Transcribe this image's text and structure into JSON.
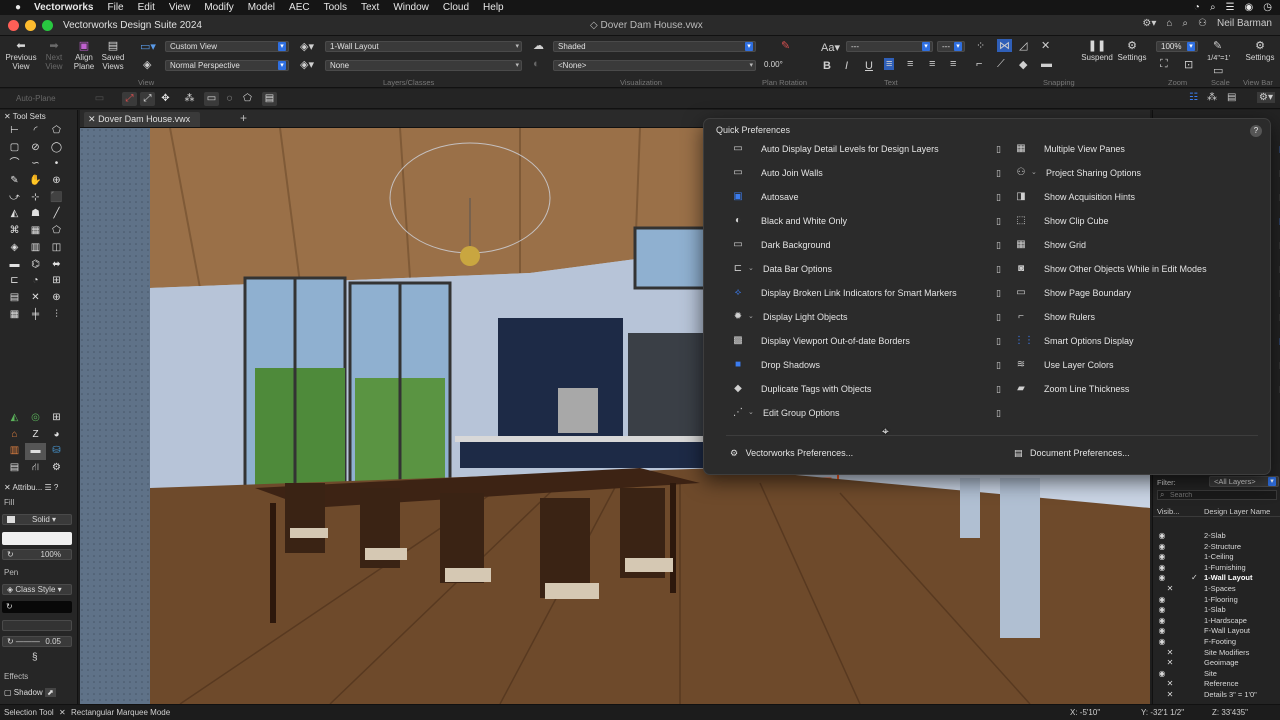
{
  "menubar": {
    "app": "Vectorworks",
    "items": [
      "File",
      "Edit",
      "View",
      "Modify",
      "Model",
      "AEC",
      "Tools",
      "Text",
      "Window",
      "Cloud",
      "Help"
    ]
  },
  "window": {
    "title": "Vectorworks Design Suite 2024",
    "document": "Dover Dam House.vwx",
    "user": "Neil Barman"
  },
  "toolbar": {
    "previous_view": "Previous\nView",
    "next_view": "Next\nView",
    "align_plane": "Align\nPlane",
    "saved_views": "Saved\nViews",
    "view_dropdown": "Custom View",
    "projection_dropdown": "Normal Perspective",
    "layer_dropdown": "1-Wall Layout",
    "class_dropdown": "None",
    "render_dropdown": "Shaded",
    "lighting_dropdown": "<None>",
    "plan_rotation_value": "0.00°",
    "zoom_value": "100%",
    "scale_value": "1/4\"=1'",
    "suspend": "Suspend",
    "settings": "Settings",
    "settings2": "Settings",
    "groups": {
      "view": "View",
      "layers_classes": "Layers/Classes",
      "visualization": "Visualization",
      "plan_rotation": "Plan Rotation",
      "text": "Text",
      "snapping": "Snapping",
      "zoom": "Zoom",
      "scale": "Scale",
      "view_bar": "View Bar"
    }
  },
  "mode_bar": {
    "auto_plane": "Auto-Plane"
  },
  "left_palette": {
    "tool_sets": "Tool Sets",
    "attributes": "Attribu...",
    "fill_label": "Fill",
    "fill_style": "Solid",
    "opacity": "100%",
    "pen_label": "Pen",
    "pen_style": "Class Style",
    "line_weight": "0.05",
    "effects_label": "Effects",
    "shadow_label": "Shadow"
  },
  "doc_tab": {
    "label": "Dover Dam House.vwx"
  },
  "quick_prefs": {
    "title": "Quick Preferences",
    "left_items": [
      {
        "label": "Auto Display Detail Levels for Design Layers",
        "icon": "detail-levels-icon",
        "caret": false,
        "pinned": false
      },
      {
        "label": "Auto Join Walls",
        "icon": "join-walls-icon",
        "caret": false,
        "pinned": false
      },
      {
        "label": "Autosave",
        "icon": "autosave-icon",
        "caret": false,
        "pinned": false
      },
      {
        "label": "Black and White Only",
        "icon": "black-white-icon",
        "caret": false,
        "pinned": false
      },
      {
        "label": "Dark Background",
        "icon": "dark-background-icon",
        "caret": false,
        "pinned": false
      },
      {
        "label": "Data Bar Options",
        "icon": "data-bar-icon",
        "caret": true,
        "pinned": false
      },
      {
        "label": "Display Broken Link Indicators for Smart Markers",
        "icon": "broken-link-icon",
        "caret": false,
        "pinned": false
      },
      {
        "label": "Display Light Objects",
        "icon": "light-objects-icon",
        "caret": true,
        "pinned": false
      },
      {
        "label": "Display Viewport Out-of-date Borders",
        "icon": "viewport-borders-icon",
        "caret": false,
        "pinned": false
      },
      {
        "label": "Drop Shadows",
        "icon": "drop-shadows-icon",
        "caret": false,
        "pinned": false
      },
      {
        "label": "Duplicate Tags with Objects",
        "icon": "duplicate-tags-icon",
        "caret": false,
        "pinned": false
      },
      {
        "label": "Edit Group Options",
        "icon": "edit-group-icon",
        "caret": true,
        "pinned": false
      }
    ],
    "right_items": [
      {
        "label": "Multiple View Panes",
        "icon": "view-panes-icon",
        "caret": false,
        "pinned": true
      },
      {
        "label": "Project Sharing Options",
        "icon": "project-sharing-icon",
        "caret": true,
        "pinned": false
      },
      {
        "label": "Show Acquisition Hints",
        "icon": "acquisition-hints-icon",
        "caret": false,
        "pinned": false
      },
      {
        "label": "Show Clip Cube",
        "icon": "clip-cube-icon",
        "caret": false,
        "pinned": true
      },
      {
        "label": "Show Grid",
        "icon": "grid-icon",
        "caret": false,
        "pinned": false
      },
      {
        "label": "Show Other Objects While in Edit Modes",
        "icon": "other-objects-icon",
        "caret": false,
        "pinned": false
      },
      {
        "label": "Show Page Boundary",
        "icon": "page-boundary-icon",
        "caret": false,
        "pinned": false
      },
      {
        "label": "Show Rulers",
        "icon": "rulers-icon",
        "caret": false,
        "pinned": false
      },
      {
        "label": "Smart Options Display",
        "icon": "smart-options-icon",
        "caret": false,
        "pinned": true
      },
      {
        "label": "Use Layer Colors",
        "icon": "layer-colors-icon",
        "caret": false,
        "pinned": false
      },
      {
        "label": "Zoom Line Thickness",
        "icon": "zoom-line-icon",
        "caret": false,
        "pinned": false
      }
    ],
    "vectorworks_prefs": "Vectorworks Preferences...",
    "document_prefs": "Document Preferences..."
  },
  "navigation": {
    "filter_label": "Filter:",
    "filter_value": "<All Layers>",
    "search_placeholder": "Search",
    "col_visibility": "Visib...",
    "col_name": "Design Layer Name",
    "layers": [
      {
        "name": "2-Slab",
        "vis": "eye",
        "active": false
      },
      {
        "name": "2-Structure",
        "vis": "eye",
        "active": false
      },
      {
        "name": "1-Ceiling",
        "vis": "eye",
        "active": false
      },
      {
        "name": "1-Furnishing",
        "vis": "eye",
        "active": false
      },
      {
        "name": "1-Wall Layout",
        "vis": "eye",
        "active": true
      },
      {
        "name": "1-Spaces",
        "vis": "x",
        "active": false
      },
      {
        "name": "1-Flooring",
        "vis": "eye",
        "active": false
      },
      {
        "name": "1-Slab",
        "vis": "eye",
        "active": false
      },
      {
        "name": "1-Hardscape",
        "vis": "eye",
        "active": false
      },
      {
        "name": "F-Wall Layout",
        "vis": "eye",
        "active": false
      },
      {
        "name": "F-Footing",
        "vis": "eye",
        "active": false
      },
      {
        "name": "Site Modifiers",
        "vis": "x",
        "active": false
      },
      {
        "name": "Geoimage",
        "vis": "x",
        "active": false
      },
      {
        "name": "Site",
        "vis": "eye",
        "active": false
      },
      {
        "name": "Reference",
        "vis": "x",
        "active": false
      },
      {
        "name": "Details 3\" = 1'0\"",
        "vis": "x",
        "active": false
      }
    ]
  },
  "status": {
    "tool": "Selection Tool",
    "mode": "Rectangular Marquee Mode",
    "x": "X: -5'10\"",
    "y": "Y: -32'1 1/2\"",
    "z": "Z: 33'435\""
  },
  "colors": {
    "accent": "#3b7cf0",
    "panel": "#2b2b2b",
    "selection_orange": "#ff5a1f"
  }
}
